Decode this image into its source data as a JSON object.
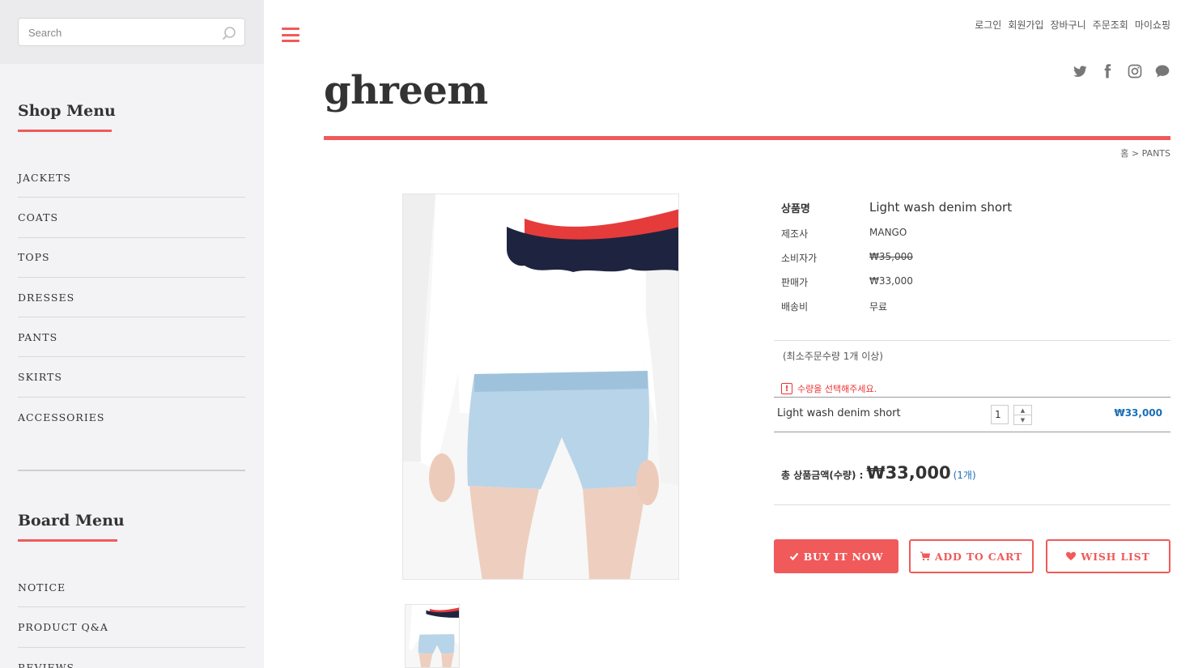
{
  "search": {
    "placeholder": "Search"
  },
  "shop_menu": {
    "title": "Shop Menu",
    "items": [
      "JACKETS",
      "COATS",
      "TOPS",
      "DRESSES",
      "PANTS",
      "SKIRTS",
      "ACCESSORIES"
    ]
  },
  "board_menu": {
    "title": "Board Menu",
    "items": [
      "NOTICE",
      "PRODUCT Q&A",
      "REVIEWS"
    ]
  },
  "header": {
    "logo": "ghreem",
    "top_links": [
      "로그인",
      "회원가입",
      "장바구니",
      "주문조회",
      "마이쇼핑"
    ],
    "social_icons": [
      "twitter-icon",
      "facebook-icon",
      "instagram-icon",
      "chat-icon"
    ],
    "breadcrumb": "홈 > PANTS"
  },
  "product": {
    "name_label": "상품명",
    "name": "Light wash denim short",
    "maker_label": "제조사",
    "maker": "MANGO",
    "consumer_price_label": "소비자가",
    "consumer_price": "₩35,000",
    "sale_price_label": "판매가",
    "sale_price": "₩33,000",
    "shipping_label": "배송비",
    "shipping": "무료",
    "min_order": "(최소주문수량 1개 이상)",
    "warning": "수량을 선택해주세요.",
    "option_name": "Light wash denim short",
    "quantity": "1",
    "option_price": "₩33,000",
    "total_label": "총 상품금액(수량) :",
    "total_amount": "₩33,000",
    "total_count": "(1개)"
  },
  "buttons": {
    "buy": "BUY IT NOW",
    "cart": "ADD TO CART",
    "wish": "WISH LIST"
  },
  "colors": {
    "accent": "#f05a5a",
    "price_blue": "#1a6fb5",
    "sidebar_bg": "#f3f3f5"
  }
}
